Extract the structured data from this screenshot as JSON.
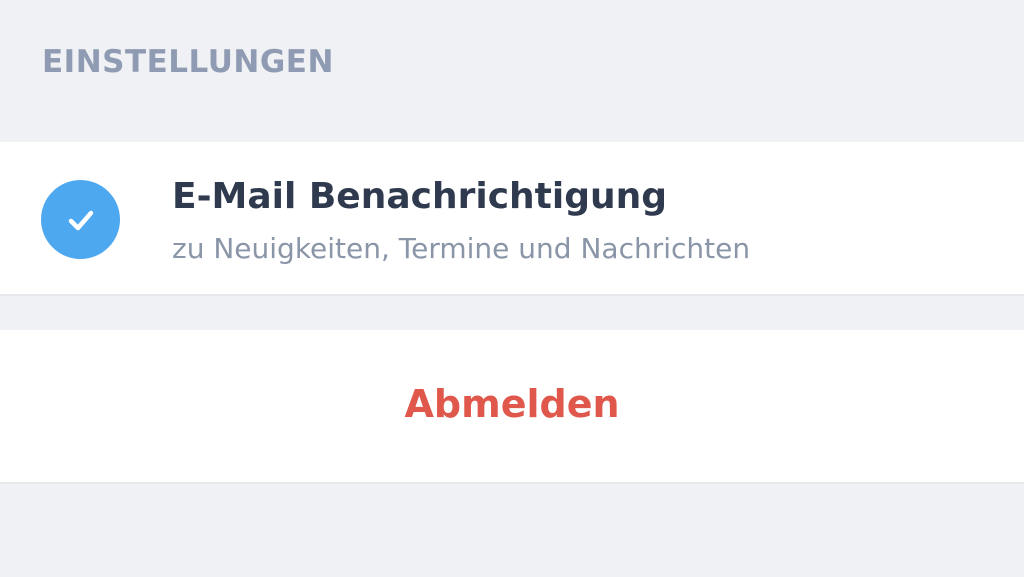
{
  "section": {
    "title": "EINSTELLUNGEN"
  },
  "email_notification": {
    "title": "E-Mail Benachrichtigung",
    "subtitle": "zu Neuigkeiten, Termine und Nachrichten",
    "checked": true,
    "icon": "checkmark-icon"
  },
  "logout": {
    "label": "Abmelden"
  },
  "colors": {
    "background": "#eff1f4",
    "header_text": "#8f9bb2",
    "accent_blue": "#4ea8ef",
    "title_text": "#2f3a4e",
    "subtitle_text": "#8b95a8",
    "logout_red": "#e0574b"
  }
}
